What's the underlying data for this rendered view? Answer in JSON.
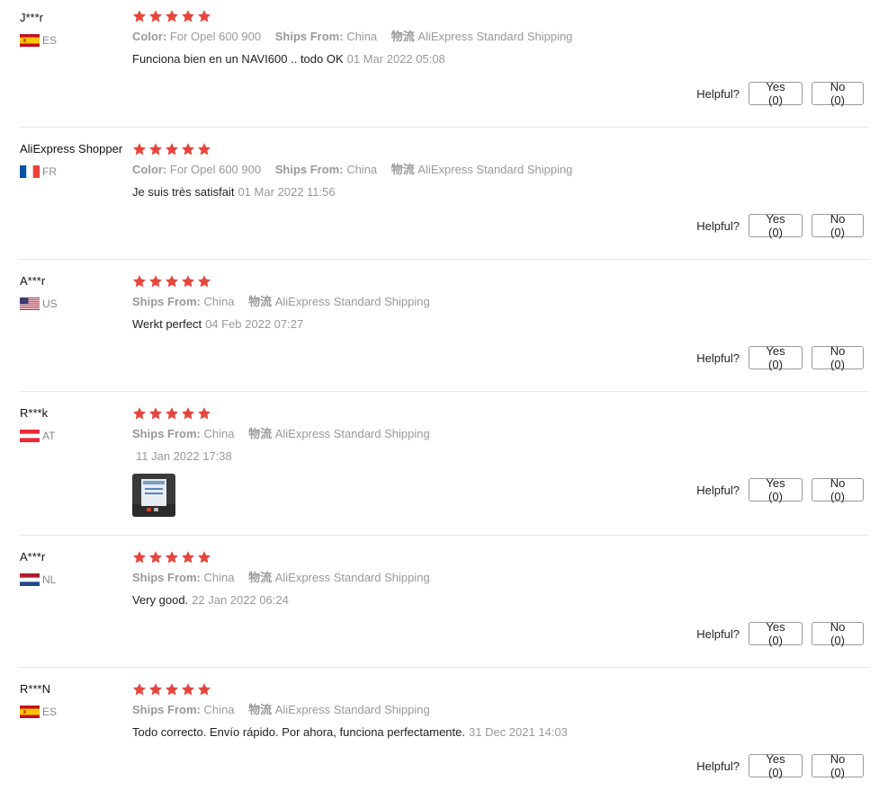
{
  "helpful_label": "Helpful?",
  "labels": {
    "color": "Color:",
    "ships_from": "Ships From:",
    "logistics": "物流"
  },
  "colors": {
    "star": "#e8453c",
    "muted": "#999999"
  },
  "reviews": [
    {
      "user": "J***r",
      "country": "ES",
      "flag_icon": "spain-flag-icon",
      "rating": 5,
      "color": "For Opel 600 900",
      "ships_from": "China",
      "logistics": "AliExpress Standard Shipping",
      "text": "Funciona bien en un NAVI600 .. todo OK",
      "date": "01 Mar 2022 05:08",
      "yes": "Yes (0)",
      "no": "No (0)"
    },
    {
      "user": "AliExpress Shopper",
      "country": "FR",
      "flag_icon": "france-flag-icon",
      "rating": 5,
      "color": "For Opel 600 900",
      "ships_from": "China",
      "logistics": "AliExpress Standard Shipping",
      "text": "Je suis très satisfait",
      "date": "01 Mar 2022 11:56",
      "yes": "Yes (0)",
      "no": "No (0)"
    },
    {
      "user": "A***r",
      "country": "US",
      "flag_icon": "usa-flag-icon",
      "rating": 5,
      "ships_from": "China",
      "logistics": "AliExpress Standard Shipping",
      "text": "Werkt perfect",
      "date": "04 Feb 2022 07:27",
      "yes": "Yes (0)",
      "no": "No (0)"
    },
    {
      "user": "R***k",
      "country": "AT",
      "flag_icon": "austria-flag-icon",
      "rating": 5,
      "ships_from": "China",
      "logistics": "AliExpress Standard Shipping",
      "text": "",
      "date": "11 Jan 2022 17:38",
      "photo_icon": "review-photo-thumbnail",
      "yes": "Yes (0)",
      "no": "No (0)"
    },
    {
      "user": "A***r",
      "country": "NL",
      "flag_icon": "netherlands-flag-icon",
      "rating": 5,
      "ships_from": "China",
      "logistics": "AliExpress Standard Shipping",
      "text": "Very good.",
      "date": "22 Jan 2022 06:24",
      "yes": "Yes (0)",
      "no": "No (0)"
    },
    {
      "user": "R***N",
      "country": "ES",
      "flag_icon": "spain-flag-icon",
      "rating": 5,
      "ships_from": "China",
      "logistics": "AliExpress Standard Shipping",
      "text": "Todo correcto. Envío rápido. Por ahora, funciona perfectamente.",
      "date": "31 Dec 2021 14:03",
      "yes": "Yes (0)",
      "no": "No (0)"
    }
  ]
}
